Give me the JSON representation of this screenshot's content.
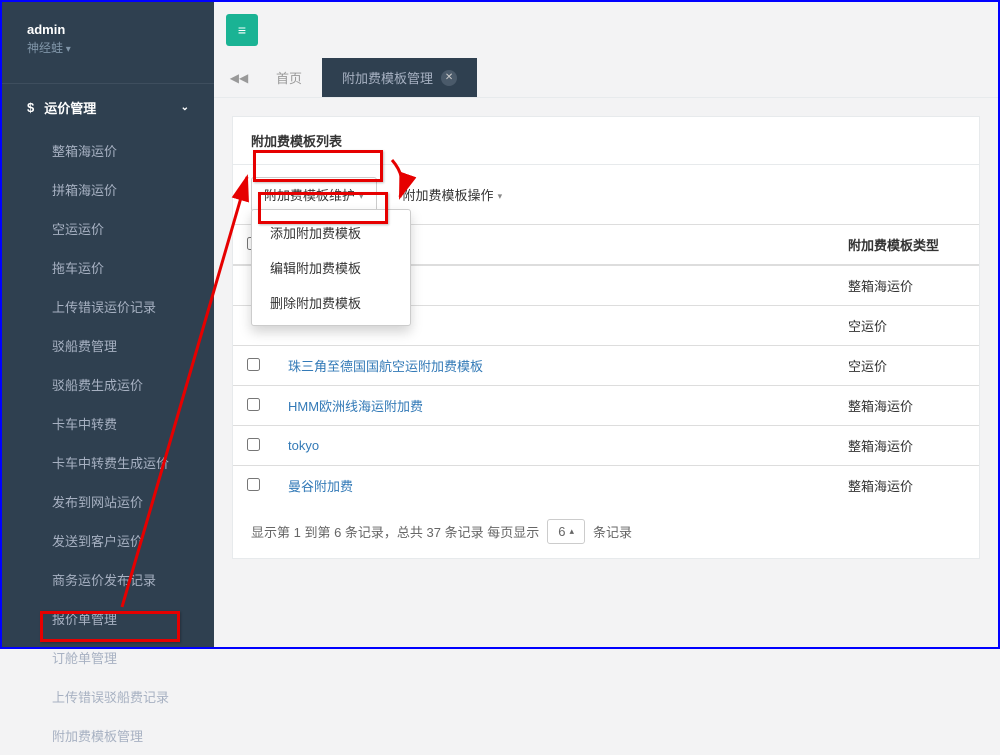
{
  "sidebar": {
    "admin_label": "admin",
    "user_label": "神经蛙",
    "menu_title": "运价管理",
    "items": [
      "整箱海运价",
      "拼箱海运价",
      "空运运价",
      "拖车运价",
      "上传错误运价记录",
      "驳船费管理",
      "驳船费生成运价",
      "卡车中转费",
      "卡车中转费生成运价",
      "发布到网站运价",
      "发送到客户运价",
      "商务运价发布记录",
      "报价单管理",
      "订舱单管理",
      "上传错误驳船费记录",
      "附加费模板管理"
    ]
  },
  "tabs": {
    "home": "首页",
    "active": "附加费模板管理"
  },
  "panel": {
    "title": "附加费模板列表"
  },
  "toolbar": {
    "maintain_label": "附加费模板维护",
    "operate_label": "附加费模板操作",
    "dropdown": [
      "添加附加费模板",
      "编辑附加费模板",
      "删除附加费模板"
    ]
  },
  "table": {
    "col_name": "",
    "col_type": "附加费模板类型",
    "rows": [
      {
        "name_hidden": "",
        "type": "整箱海运价"
      },
      {
        "name_hidden": "",
        "type": "空运价"
      },
      {
        "name": "珠三角至德国国航空运附加费模板",
        "type": "空运价"
      },
      {
        "name": "HMM欧洲线海运附加费",
        "type": "整箱海运价"
      },
      {
        "name": "tokyo",
        "type": "整箱海运价"
      },
      {
        "name": "曼谷附加费",
        "type": "整箱海运价"
      }
    ]
  },
  "pagination": {
    "prefix": "显示第 1 到第 6 条记录，总共 37 条记录  每页显示",
    "size": "6",
    "suffix": "条记录"
  }
}
